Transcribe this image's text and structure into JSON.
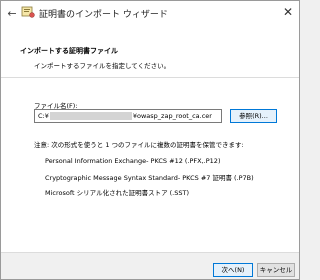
{
  "window": {
    "title": "証明書のインポート ウィザード",
    "close_glyph": "✕",
    "back_glyph": "←"
  },
  "header": {
    "title": "インポートする証明書ファイル",
    "subtitle": "インポートするファイルを指定してください。"
  },
  "file": {
    "label": "ファイル名(F):",
    "value_prefix": "C:¥",
    "value_suffix": "¥owasp_zap_root_ca.cer",
    "browse_label": "参照(R)..."
  },
  "note": "注意: 次の形式を使うと 1 つのファイルに複数の証明書を保管できます:",
  "formats": [
    "Personal Information Exchange- PKCS #12 (.PFX,.P12)",
    "Cryptographic Message Syntax Standard- PKCS #7 証明書 (.P7B)",
    "Microsoft シリアル化された証明書ストア (.SST)"
  ],
  "buttons": {
    "next": "次へ(N)",
    "cancel": "キャンセル"
  },
  "colors": {
    "accent": "#0078d7",
    "redaction": "#d4d4d4"
  }
}
